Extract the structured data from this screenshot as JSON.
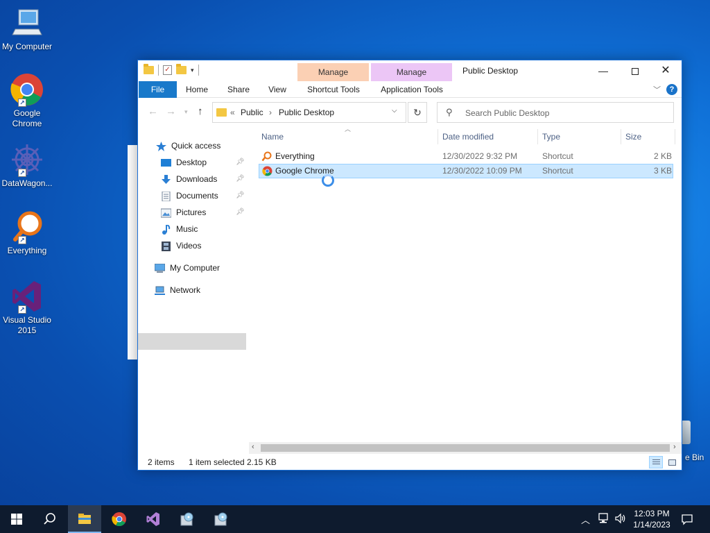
{
  "desktop": {
    "icons": [
      {
        "label": "My Computer",
        "icon": "computer-icon"
      },
      {
        "label": "Google Chrome",
        "icon": "chrome-icon"
      },
      {
        "label": "DataWagon...",
        "icon": "datawagon-icon"
      },
      {
        "label": "Everything",
        "icon": "everything-icon"
      },
      {
        "label": "Visual Studio 2015",
        "icon": "visual-studio-icon"
      }
    ],
    "recycle_bin_partial_label": "e Bin"
  },
  "window": {
    "title": "Public Desktop",
    "contextual_groups": {
      "shortcut_tools": {
        "group_label": "Manage",
        "tab_label": "Shortcut Tools"
      },
      "application_tools": {
        "group_label": "Manage",
        "tab_label": "Application Tools"
      }
    },
    "ribbon_tabs": [
      "File",
      "Home",
      "Share",
      "View"
    ],
    "controls": {
      "minimize": "—",
      "maximize": "",
      "close": "✕"
    },
    "help_label": "?"
  },
  "address_bar": {
    "overflow": "«",
    "segments": [
      "Public",
      "Public Desktop"
    ],
    "separator": "›"
  },
  "search": {
    "placeholder": "Search Public Desktop"
  },
  "nav_pane": {
    "quick_access": "Quick access",
    "items": [
      {
        "label": "Desktop",
        "pinned": true
      },
      {
        "label": "Downloads",
        "pinned": true
      },
      {
        "label": "Documents",
        "pinned": true
      },
      {
        "label": "Pictures",
        "pinned": true
      },
      {
        "label": "Music",
        "pinned": false
      },
      {
        "label": "Videos",
        "pinned": false
      }
    ],
    "my_computer": "My Computer",
    "network": "Network"
  },
  "file_list": {
    "columns": [
      "Name",
      "Date modified",
      "Type",
      "Size"
    ],
    "rows": [
      {
        "name": "Everything",
        "date": "12/30/2022 9:32 PM",
        "type": "Shortcut",
        "size": "2 KB",
        "selected": false
      },
      {
        "name": "Google Chrome",
        "date": "12/30/2022 10:09 PM",
        "type": "Shortcut",
        "size": "3 KB",
        "selected": true
      }
    ]
  },
  "status_bar": {
    "item_count": "2 items",
    "selection": "1 item selected",
    "selection_size": "2.15 KB"
  },
  "taskbar": {
    "clock_time": "12:03 PM",
    "clock_date": "1/14/2023"
  },
  "colors": {
    "accent": "#1979ca",
    "selection_bg": "#cce8ff",
    "shortcut_tools": "#fbd0b4",
    "application_tools": "#ecc6f6",
    "taskbar": "#0e1b2e"
  }
}
